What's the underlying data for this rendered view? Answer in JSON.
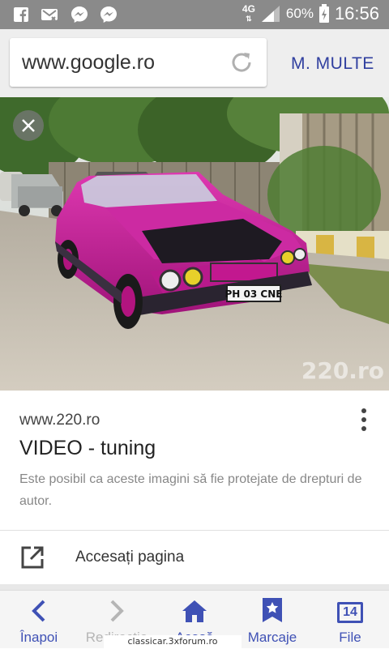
{
  "status_bar": {
    "icons": [
      "facebook-icon",
      "missed-call-icon",
      "messenger-icon",
      "messenger-icon"
    ],
    "network": "4G",
    "battery": "60%",
    "time": "16:56"
  },
  "url_bar": {
    "url": "www.google.ro",
    "more_label": "M. MULTE"
  },
  "image_view": {
    "watermark": "220.ro",
    "plate": "PH 03 CNE"
  },
  "result": {
    "domain": "www.220.ro",
    "title": "VIDEO - tuning",
    "copyright_note": "Este posibil ca aceste imagini să fie protejate de drepturi de autor."
  },
  "action": {
    "visit_label": "Accesați pagina"
  },
  "bottom_nav": {
    "items": [
      {
        "label": "Înapoi",
        "icon": "back-arrow-icon",
        "enabled": true
      },
      {
        "label": "Redirecție",
        "icon": "forward-arrow-icon",
        "enabled": false
      },
      {
        "label": "Acasă",
        "icon": "home-icon",
        "enabled": true
      },
      {
        "label": "Marcaje",
        "icon": "bookmark-icon",
        "enabled": true
      },
      {
        "label": "File",
        "icon": "tabs-icon",
        "enabled": true
      }
    ],
    "tab_count": "14"
  },
  "overlay_text": "classicar.3xforum.ro",
  "colors": {
    "accent": "#3f51b5",
    "status_bar": "#8a8a8a",
    "car": "#c2188f"
  }
}
